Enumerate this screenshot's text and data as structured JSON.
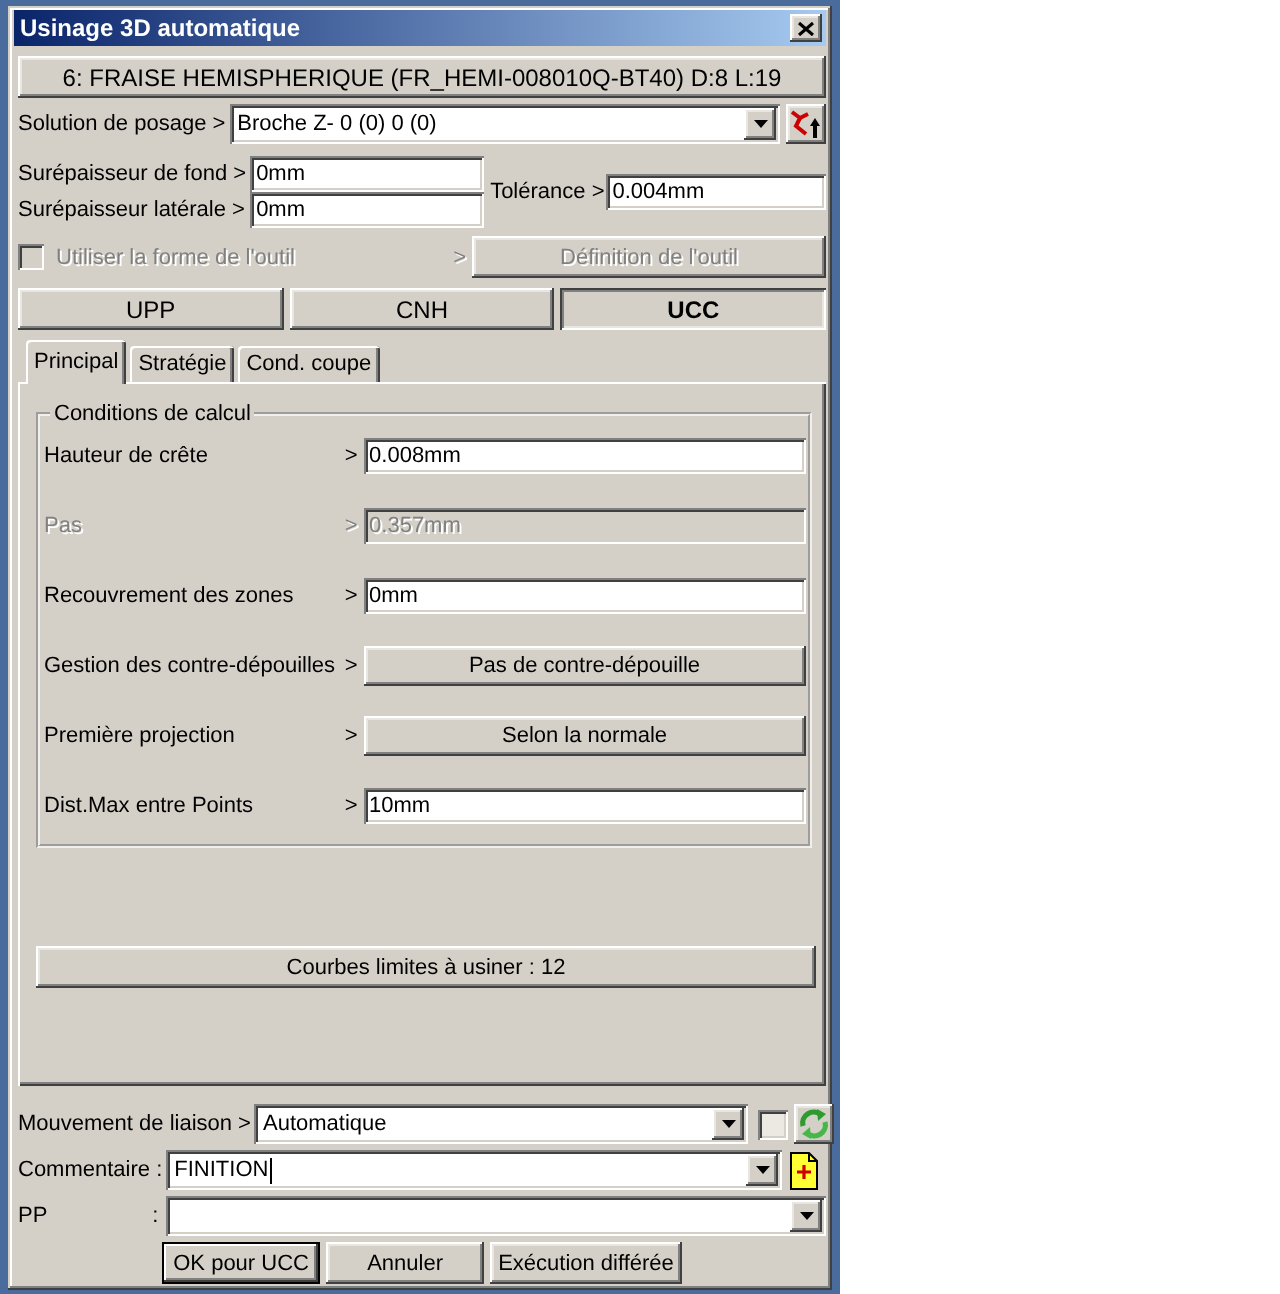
{
  "window": {
    "title": "Usinage 3D automatique"
  },
  "tool": {
    "label": "6: FRAISE HEMISPHERIQUE (FR_HEMI-008010Q-BT40)  D:8  L:19"
  },
  "fixture": {
    "label": "Solution de posage >",
    "value": "Broche  Z-  0 (0)  0 (0)"
  },
  "allowances": [
    {
      "label": "Surépaisseur de fond >",
      "value": "0mm"
    },
    {
      "label": "Surépaisseur latérale >",
      "value": "0mm"
    }
  ],
  "tolerance": {
    "label": "Tolérance >",
    "value": "0.004mm"
  },
  "tool_shape": {
    "label": "Utiliser la forme de l'outil",
    "checked": false,
    "disabled": true,
    "arrow": ">",
    "button": "Définition de l'outil"
  },
  "modes": [
    {
      "label": "UPP",
      "selected": false
    },
    {
      "label": "CNH",
      "selected": false
    },
    {
      "label": "UCC",
      "selected": true
    }
  ],
  "tabs": [
    {
      "label": "Principal",
      "selected": true
    },
    {
      "label": "Stratégie",
      "selected": false
    },
    {
      "label": "Cond. coupe",
      "selected": false
    }
  ],
  "calc_conditions": {
    "title": "Conditions de calcul",
    "rows": [
      {
        "kind": "field",
        "label": "Hauteur de crête",
        "arrow": ">",
        "value": "0.008mm",
        "disabled": false
      },
      {
        "kind": "field",
        "label": "Pas",
        "arrow": ">",
        "value": "0.357mm",
        "disabled": true
      },
      {
        "kind": "field",
        "label": "Recouvrement des zones",
        "arrow": ">",
        "value": "0mm",
        "disabled": false
      },
      {
        "kind": "button",
        "label": "Gestion des contre-dépouilles",
        "arrow": ">",
        "value": "Pas de contre-dépouille",
        "disabled": false
      },
      {
        "kind": "button",
        "label": "Première projection",
        "arrow": ">",
        "value": "Selon la normale",
        "disabled": false
      },
      {
        "kind": "field",
        "label": "Dist.Max entre Points",
        "arrow": ">",
        "value": "10mm",
        "disabled": false
      }
    ]
  },
  "curves_button": "Courbes limites à usiner : 12",
  "link_motion": {
    "label": "Mouvement de liaison >",
    "value": "Automatique",
    "option_checked": false
  },
  "comment": {
    "label": "Commentaire :",
    "value": "FINITION",
    "focused": true
  },
  "pp": {
    "label": "PP",
    "separator": ":"
  },
  "buttons": [
    {
      "label": "OK pour UCC",
      "default": true
    },
    {
      "label": "Annuler",
      "default": false
    },
    {
      "label": "Exécution différée",
      "default": false
    }
  ]
}
